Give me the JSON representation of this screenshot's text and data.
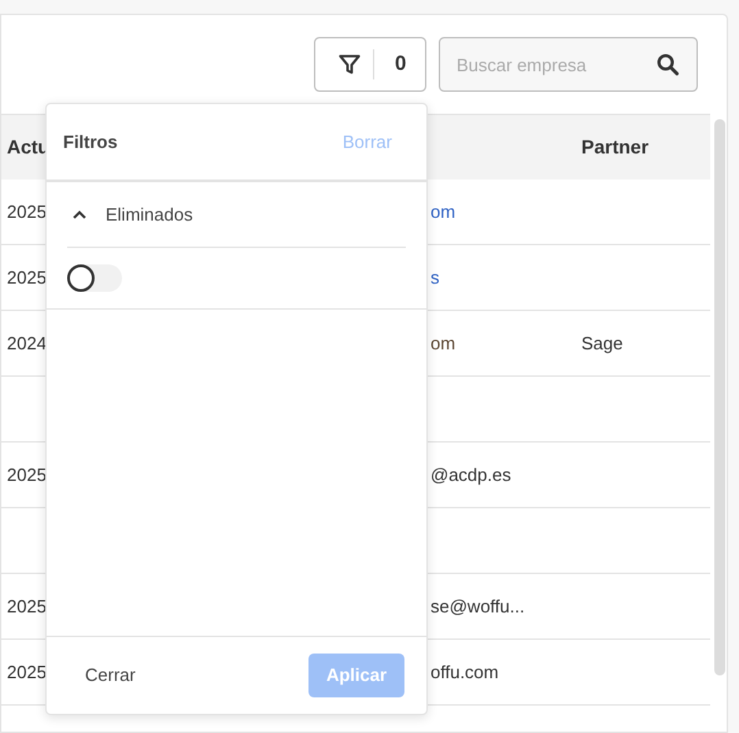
{
  "toolbar": {
    "filter_count": "0",
    "search": {
      "placeholder": "Buscar empresa"
    }
  },
  "table": {
    "columns": [
      {
        "label": "Actu"
      },
      {
        "label": "Partner"
      }
    ],
    "rows": [
      {
        "column_1": "2025",
        "column_2": {
          "text": "om",
          "kind": "link"
        }
      },
      {
        "column_1": "2025",
        "column_2": {
          "text": "s",
          "kind": "link"
        }
      },
      {
        "column_1": "2024",
        "column_2": {
          "text": "om",
          "kind": "muted"
        },
        "partner": "Sage"
      },
      {},
      {
        "column_1": "2025",
        "column_2": {
          "text": "@acdp.es",
          "kind": "text"
        }
      },
      {},
      {
        "column_1": "2025",
        "column_2": {
          "text": "se@woffu...",
          "kind": "text"
        }
      },
      {
        "column_1": "2025",
        "column_2": {
          "text": "offu.com",
          "kind": "text"
        }
      }
    ]
  },
  "filters_popup": {
    "title": "Filtros",
    "clear": {
      "label": "Borrar",
      "disabled": true
    },
    "sections": [
      {
        "label": "Eliminados",
        "expanded": true,
        "toggle": {
          "on": false
        }
      }
    ],
    "close": "Cerrar",
    "apply": {
      "label": "Aplicar",
      "disabled": true
    }
  }
}
